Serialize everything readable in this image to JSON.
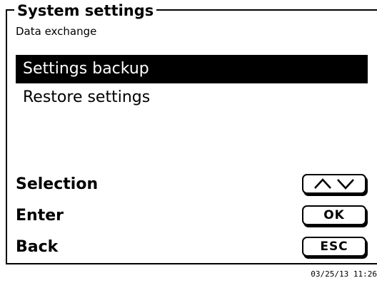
{
  "header": {
    "title": "System settings",
    "subtitle": "Data exchange"
  },
  "menu": {
    "items": [
      {
        "label": "Settings backup",
        "selected": true
      },
      {
        "label": "Restore settings",
        "selected": false
      }
    ]
  },
  "actions": {
    "selection": {
      "label": "Selection",
      "key_icon": "up-down-arrows-icon"
    },
    "enter": {
      "label": "Enter",
      "key_label": "OK"
    },
    "back": {
      "label": "Back",
      "key_label": "ESC"
    }
  },
  "status": {
    "timestamp": "03/25/13 11:26"
  },
  "colors": {
    "foreground": "#000000",
    "background": "#ffffff",
    "selection_background": "#000000",
    "selection_text": "#ffffff"
  }
}
